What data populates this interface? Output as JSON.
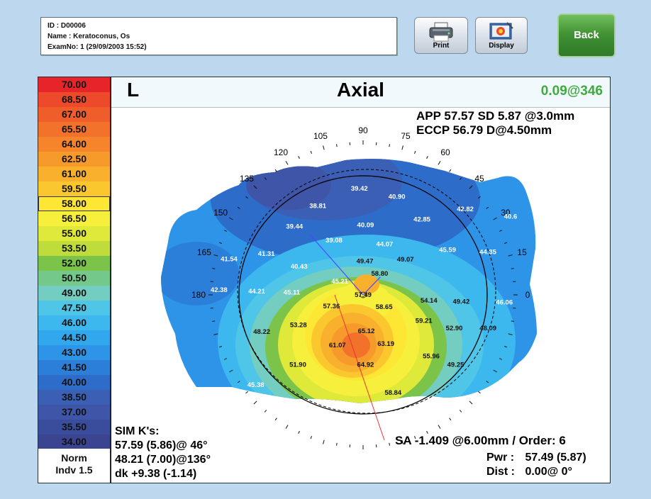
{
  "patient": {
    "id_line": "ID : D00006",
    "name_line": "Name : Keratoconus, Os",
    "exam_line": "ExamNo: 1 (29/09/2003 15:52)"
  },
  "toolbar": {
    "print_label": "Print",
    "display_label": "Display",
    "back_label": "Back"
  },
  "colors": {
    "back_button": "#3f8f33",
    "panel_header": "#f2f9fd",
    "k_value": "#3dab3d"
  },
  "scale": {
    "steps": [
      {
        "label": "70.00",
        "color": "#e6242a"
      },
      {
        "label": "68.50",
        "color": "#ec4a2a"
      },
      {
        "label": "67.00",
        "color": "#ef5d2b"
      },
      {
        "label": "65.50",
        "color": "#f2712b"
      },
      {
        "label": "64.00",
        "color": "#f5842b"
      },
      {
        "label": "62.50",
        "color": "#f79a2c"
      },
      {
        "label": "61.00",
        "color": "#f9b02d"
      },
      {
        "label": "59.50",
        "color": "#fbc72f"
      },
      {
        "label": "58.00",
        "color": "#fde634"
      },
      {
        "label": "56.50",
        "color": "#f6f03c"
      },
      {
        "label": "55.00",
        "color": "#dfe93a"
      },
      {
        "label": "53.50",
        "color": "#bfdc3a"
      },
      {
        "label": "52.00",
        "color": "#7cc349"
      },
      {
        "label": "50.50",
        "color": "#74c98a"
      },
      {
        "label": "49.00",
        "color": "#73cdc0"
      },
      {
        "label": "47.50",
        "color": "#4fc6e8"
      },
      {
        "label": "46.00",
        "color": "#3cb8ef"
      },
      {
        "label": "44.50",
        "color": "#31a7ee"
      },
      {
        "label": "43.00",
        "color": "#2d94e8"
      },
      {
        "label": "41.50",
        "color": "#2c7fd9"
      },
      {
        "label": "40.00",
        "color": "#2d6cc9"
      },
      {
        "label": "38.50",
        "color": "#3a5fb5"
      },
      {
        "label": "37.00",
        "color": "#3f55a8"
      },
      {
        "label": "35.50",
        "color": "#3a4c9c"
      },
      {
        "label": "34.00",
        "color": "#3a4490"
      }
    ],
    "selected_index": 8,
    "norm_label": "Norm",
    "indv_label": "Indv 1.5"
  },
  "map": {
    "eye": "L",
    "title": "Axial",
    "k_value": "0.09@346",
    "app_line": "APP 57.57 SD 5.87  @3.0mm",
    "eccp_line": "ECCP 56.79 D@4.50mm",
    "angles": [
      "0",
      "15",
      "30",
      "45",
      "60",
      "75",
      "90",
      "105",
      "120",
      "135",
      "150",
      "165",
      "180"
    ],
    "values": [
      {
        "v": "38.81",
        "a": 117,
        "r": 0.74
      },
      {
        "v": "39.42",
        "a": 92,
        "r": 0.79
      },
      {
        "v": "40.90",
        "a": 71,
        "r": 0.77
      },
      {
        "v": "39.44",
        "a": 135,
        "r": 0.72
      },
      {
        "v": "40.09",
        "a": 88,
        "r": 0.52
      },
      {
        "v": "39.08",
        "a": 118,
        "r": 0.46
      },
      {
        "v": "42.85",
        "a": 52,
        "r": 0.71
      },
      {
        "v": "42.82",
        "a": 40,
        "r": 0.99
      },
      {
        "v": "40.6",
        "a": 28,
        "r": 1.24
      },
      {
        "v": "41.54",
        "a": 165,
        "r": 1.03
      },
      {
        "v": "41.31",
        "a": 157,
        "r": 0.78
      },
      {
        "v": "40.43",
        "a": 156,
        "r": 0.52
      },
      {
        "v": "44.07",
        "a": 67,
        "r": 0.41
      },
      {
        "v": "45.59",
        "a": 28,
        "r": 0.71
      },
      {
        "v": "44.35",
        "a": 19,
        "r": 0.98
      },
      {
        "v": "49.47",
        "a": 87,
        "r": 0.25
      },
      {
        "v": "49.07",
        "a": 40,
        "r": 0.41
      },
      {
        "v": "45.21",
        "a": 150,
        "r": 0.2
      },
      {
        "v": "58.80",
        "a": 52,
        "r": 0.2
      },
      {
        "v": "42.38",
        "a": 178,
        "r": 1.07
      },
      {
        "v": "44.21",
        "a": 178,
        "r": 0.79
      },
      {
        "v": "45.11",
        "a": 178,
        "r": 0.53
      },
      {
        "v": "57.49",
        "a": 0,
        "r": 0.0
      },
      {
        "v": "54.14",
        "a": 355,
        "r": 0.49
      },
      {
        "v": "49.42",
        "a": 356,
        "r": 0.73
      },
      {
        "v": "46.06",
        "a": 357,
        "r": 1.05
      },
      {
        "v": "57.36",
        "a": 200,
        "r": 0.25
      },
      {
        "v": "58.65",
        "a": 330,
        "r": 0.18
      },
      {
        "v": "48.22",
        "a": 200,
        "r": 0.8
      },
      {
        "v": "53.28",
        "a": 205,
        "r": 0.53
      },
      {
        "v": "65.12",
        "a": 275,
        "r": 0.27
      },
      {
        "v": "59.21",
        "a": 337,
        "r": 0.49
      },
      {
        "v": "52.90",
        "a": 340,
        "r": 0.72
      },
      {
        "v": "48.09",
        "a": 345,
        "r": 0.96
      },
      {
        "v": "61.07",
        "a": 243,
        "r": 0.42
      },
      {
        "v": "63.19",
        "a": 295,
        "r": 0.4
      },
      {
        "v": "51.90",
        "a": 227,
        "r": 0.71
      },
      {
        "v": "64.92",
        "a": 272,
        "r": 0.52
      },
      {
        "v": "55.96",
        "a": 318,
        "r": 0.68
      },
      {
        "v": "45.38",
        "a": 220,
        "r": 1.04
      },
      {
        "v": "49.25",
        "a": 323,
        "r": 0.86
      },
      {
        "v": "58.84",
        "a": 287,
        "r": 0.76
      }
    ]
  },
  "sim_k": {
    "title": "SIM K's:",
    "k1": "57.59 (5.86)@ 46°",
    "k2": "48.21 (7.00)@136°",
    "dk": "dk +9.38 (-1.14)"
  },
  "footer": {
    "sa_line": "SA -1.409 @6.00mm / Order: 6",
    "pwr_label": "Pwr :",
    "pwr_value": "57.49 (5.87)",
    "dist_label": "Dist :",
    "dist_value": "0.00@  0°"
  }
}
